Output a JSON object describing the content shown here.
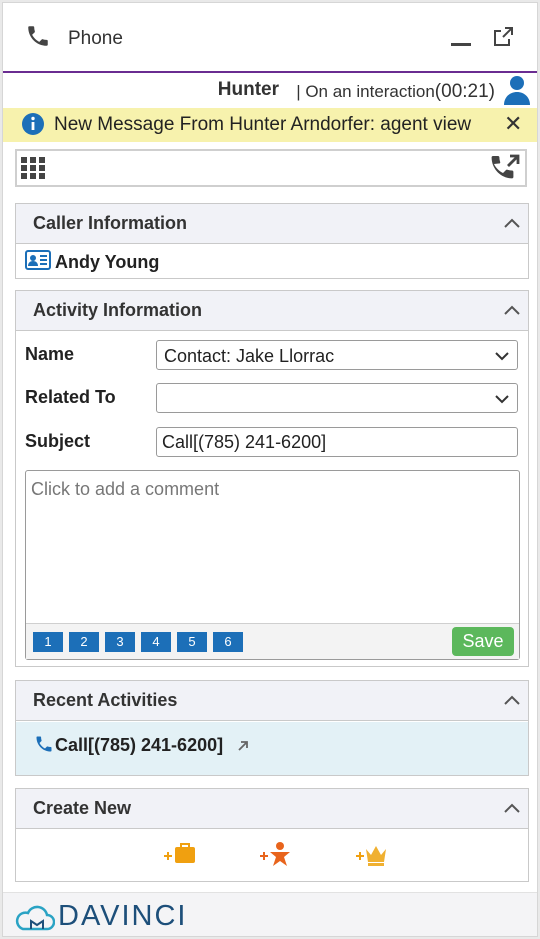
{
  "window": {
    "title": "Phone"
  },
  "agent": {
    "name": "Hunter",
    "separator": " | ",
    "status": "On an interaction",
    "timer": "(00:21)"
  },
  "notification": {
    "message": "New Message From Hunter Arndorfer: agent view",
    "close_label": "✕"
  },
  "caller_info": {
    "title": "Caller Information",
    "name": "Andy Young"
  },
  "activity_info": {
    "title": "Activity Information",
    "name_label": "Name",
    "name_value": "Contact: Jake Llorrac",
    "related_label": "Related To",
    "related_value": "",
    "subject_label": "Subject",
    "subject_value": "Call[(785) 241-6200]",
    "comment_placeholder": "Click to add a comment",
    "quick_buttons": [
      "1",
      "2",
      "3",
      "4",
      "5",
      "6"
    ],
    "save_label": "Save"
  },
  "recent_activities": {
    "title": "Recent Activities",
    "items": [
      {
        "label": "Call[(785) 241-6200]"
      }
    ]
  },
  "create_new": {
    "title": "Create New",
    "icons": [
      "add-case-icon",
      "add-contact-icon",
      "add-lead-icon"
    ]
  },
  "footer": {
    "logo_text": "DAVINCI"
  },
  "colors": {
    "accent_purple": "#6a2c91",
    "notification_bg": "#f7f2ad",
    "info_blue": "#1c6fb8",
    "save_green": "#5cb85c",
    "create_orange": "#f0a010",
    "brand_navy": "#1d4f7a"
  }
}
